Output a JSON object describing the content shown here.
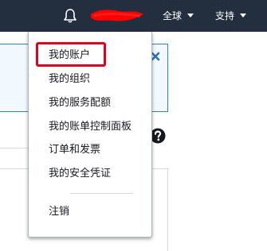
{
  "topbar": {
    "bell_icon": "bell-icon",
    "region_label": "全球",
    "support_label": "支持"
  },
  "account_menu": {
    "items": [
      {
        "label": "我的账户",
        "highlighted": true
      },
      {
        "label": "我的组织"
      },
      {
        "label": "我的服务配额"
      },
      {
        "label": "我的账单控制面板"
      },
      {
        "label": "订单和发票"
      },
      {
        "label": "我的安全凭证"
      }
    ],
    "signout_label": "注销"
  },
  "background": {
    "close_icon": "close-icon",
    "help_icon": "help-icon"
  },
  "colors": {
    "topbar_bg": "#232f3e",
    "info_border": "#2a82d1",
    "highlight_red": "#e3001b",
    "redaction_red": "#ff0000"
  }
}
